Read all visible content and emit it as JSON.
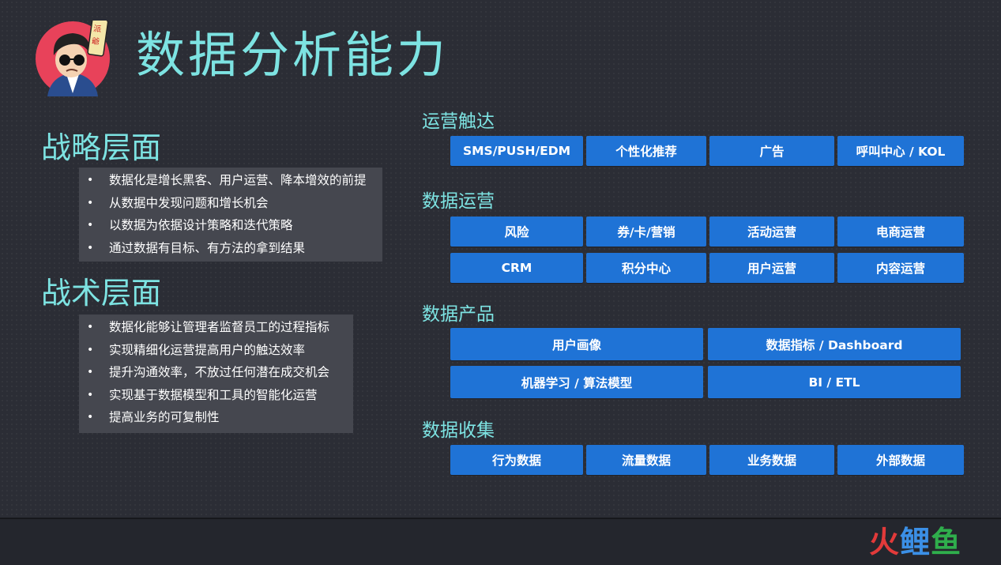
{
  "title": "数据分析能力",
  "avatar": {
    "badge": "派 爺"
  },
  "strategic": {
    "heading": "战略层面",
    "items": [
      "数据化是增长黑客、用户运营、降本增效的前提",
      "从数据中发现问题和增长机会",
      "以数据为依据设计策略和迭代策略",
      "通过数据有目标、有方法的拿到结果"
    ]
  },
  "tactical": {
    "heading": "战术层面",
    "items": [
      "数据化能够让管理者监督员工的过程指标",
      "实现精细化运营提高用户的触达效率",
      "提升沟通效率，不放过任何潜在成交机会",
      "实现基于数据模型和工具的智能化运营",
      "提高业务的可复制性"
    ]
  },
  "groups": {
    "reach": {
      "heading": "运营触达",
      "buttons": [
        "SMS/PUSH/EDM",
        "个性化推荐",
        "广告",
        "呼叫中心 / KOL"
      ]
    },
    "operation": {
      "heading": "数据运营",
      "buttons": [
        "风险",
        "券/卡/营销",
        "活动运营",
        "电商运营",
        "CRM",
        "积分中心",
        "用户运营",
        "内容运营"
      ]
    },
    "product": {
      "heading": "数据产品",
      "buttons": [
        "用户画像",
        "数据指标 / Dashboard",
        "机器学习 / 算法模型",
        "BI / ETL"
      ]
    },
    "collection": {
      "heading": "数据收集",
      "buttons": [
        "行为数据",
        "流量数据",
        "业务数据",
        "外部数据"
      ]
    }
  },
  "footer_logo": {
    "part1": "火",
    "part2": "鲤",
    "part3": "鱼"
  },
  "colors": {
    "background": "#2b2d35",
    "accent": "#7de3e2",
    "button": "#1f73d6",
    "bullet_box": "#45474f"
  }
}
